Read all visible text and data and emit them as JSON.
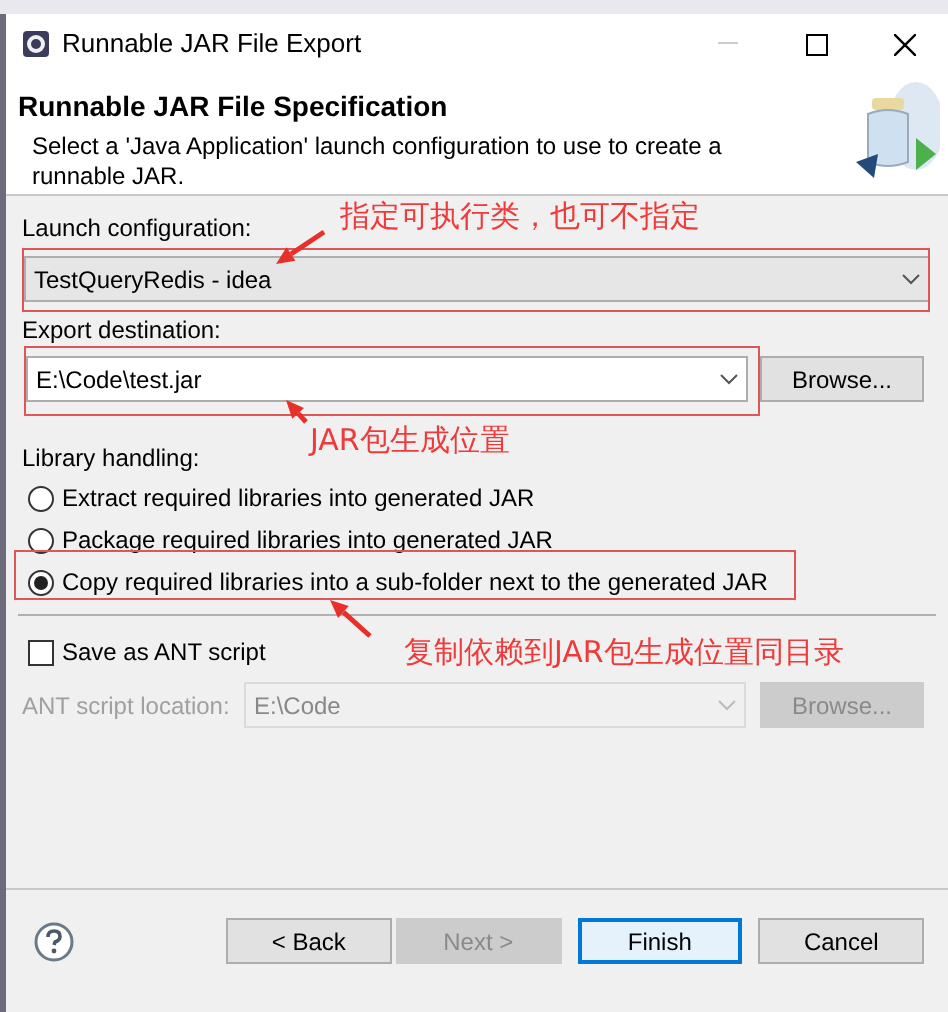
{
  "window": {
    "title": "Runnable JAR File Export"
  },
  "header": {
    "title": "Runnable JAR File Specification",
    "description": "Select a 'Java Application' launch configuration to use to create a runnable JAR."
  },
  "launch_configuration": {
    "label": "Launch configuration:",
    "value": "TestQueryRedis - idea"
  },
  "export_destination": {
    "label": "Export destination:",
    "value": "E:\\Code\\test.jar",
    "button": "Browse..."
  },
  "library_handling": {
    "label": "Library handling:",
    "options": [
      {
        "label": "Extract required libraries into generated JAR",
        "selected": false
      },
      {
        "label": "Package required libraries into generated JAR",
        "selected": false
      },
      {
        "label": "Copy required libraries into a sub-folder next to the generated JAR",
        "selected": true
      }
    ]
  },
  "ant_script": {
    "label": "Save as ANT script",
    "checked": false
  },
  "ant_location": {
    "label": "ANT script location:",
    "value": "E:\\Code",
    "button": "Browse...",
    "disabled": true
  },
  "buttons": [
    {
      "label": "< Back",
      "disabled": false,
      "default": false
    },
    {
      "label": "Next >",
      "disabled": true,
      "default": false
    },
    {
      "label": "Finish",
      "disabled": false,
      "default": true
    },
    {
      "label": "Cancel",
      "disabled": false,
      "default": false
    }
  ],
  "annotations": [
    {
      "text": "指定可执行类，也可不指定"
    },
    {
      "text": "JAR包生成位置"
    },
    {
      "text": "复制依赖到JAR包生成位置同目录"
    }
  ]
}
